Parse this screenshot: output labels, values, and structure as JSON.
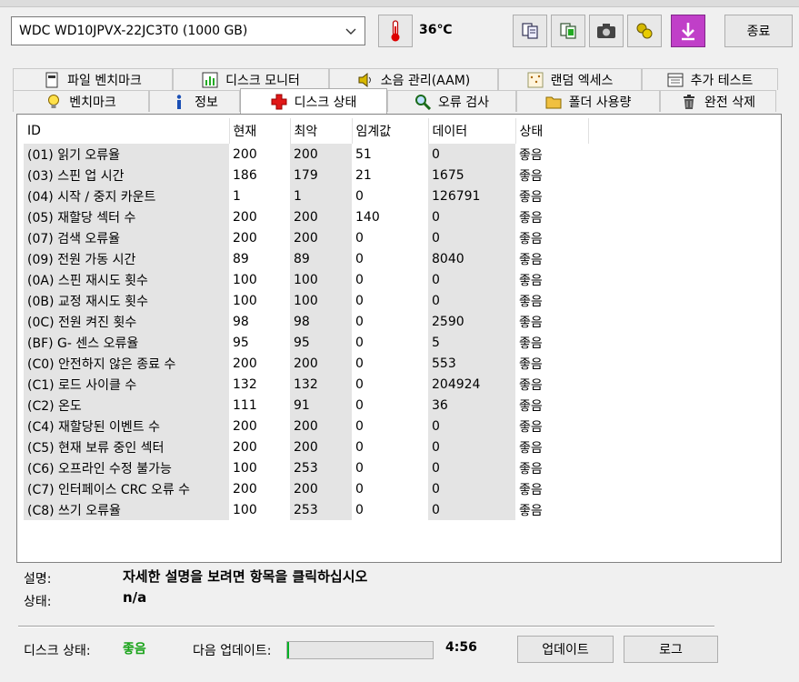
{
  "toolbar": {
    "drive": "WDC WD10JPVX-22JC3T0 (1000 GB)",
    "temperature": "36℃",
    "close_label": "종료"
  },
  "tabs_top": [
    {
      "label": "파일 벤치마크",
      "icon": "file-benchmark-icon"
    },
    {
      "label": "디스크 모니터",
      "icon": "chart-icon"
    },
    {
      "label": "소음 관리(AAM)",
      "icon": "speaker-icon"
    },
    {
      "label": "랜덤 엑세스",
      "icon": "random-access-icon"
    },
    {
      "label": "추가 테스트",
      "icon": "extra-test-icon"
    }
  ],
  "tabs_bottom": [
    {
      "label": "벤치마크",
      "icon": "lightbulb-icon"
    },
    {
      "label": "정보",
      "icon": "info-icon"
    },
    {
      "label": "디스크 상태",
      "icon": "health-cross-icon"
    },
    {
      "label": "오류 검사",
      "icon": "magnifier-icon"
    },
    {
      "label": "폴더 사용량",
      "icon": "folder-icon"
    },
    {
      "label": "완전 삭제",
      "icon": "trash-icon"
    }
  ],
  "table": {
    "headers": [
      "ID",
      "현재",
      "최악",
      "임계값",
      "데이터",
      "상태"
    ],
    "rows": [
      [
        "(01) 읽기 오류율",
        "200",
        "200",
        "51",
        "0",
        "좋음"
      ],
      [
        "(03) 스핀 업 시간",
        "186",
        "179",
        "21",
        "1675",
        "좋음"
      ],
      [
        "(04) 시작 / 중지 카운트",
        "1",
        "1",
        "0",
        "126791",
        "좋음"
      ],
      [
        "(05) 재할당 섹터 수",
        "200",
        "200",
        "140",
        "0",
        "좋음"
      ],
      [
        "(07) 검색 오류율",
        "200",
        "200",
        "0",
        "0",
        "좋음"
      ],
      [
        "(09) 전원 가동 시간",
        "89",
        "89",
        "0",
        "8040",
        "좋음"
      ],
      [
        "(0A) 스핀 재시도 횟수",
        "100",
        "100",
        "0",
        "0",
        "좋음"
      ],
      [
        "(0B) 교정 재시도 횟수",
        "100",
        "100",
        "0",
        "0",
        "좋음"
      ],
      [
        "(0C) 전원 켜진 횟수",
        "98",
        "98",
        "0",
        "2590",
        "좋음"
      ],
      [
        "(BF) G- 센스 오류율",
        "95",
        "95",
        "0",
        "5",
        "좋음"
      ],
      [
        "(C0) 안전하지 않은 종료 수",
        "200",
        "200",
        "0",
        "553",
        "좋음"
      ],
      [
        "(C1) 로드 사이클 수",
        "132",
        "132",
        "0",
        "204924",
        "좋음"
      ],
      [
        "(C2) 온도",
        "111",
        "91",
        "0",
        "36",
        "좋음"
      ],
      [
        "(C4) 재할당된 이벤트 수",
        "200",
        "200",
        "0",
        "0",
        "좋음"
      ],
      [
        "(C5) 현재 보류 중인 섹터",
        "200",
        "200",
        "0",
        "0",
        "좋음"
      ],
      [
        "(C6) 오프라인 수정 불가능",
        "100",
        "253",
        "0",
        "0",
        "좋음"
      ],
      [
        "(C7) 인터페이스 CRC 오류 수",
        "200",
        "200",
        "0",
        "0",
        "좋음"
      ],
      [
        "(C8) 쓰기 오류율",
        "100",
        "253",
        "0",
        "0",
        "좋음"
      ]
    ]
  },
  "description": {
    "desc_label": "설명:",
    "desc_value": "자세한 설명을 보려면 항목을 클릭하십시오",
    "status_label": "상태:",
    "status_value": "n/a"
  },
  "footer": {
    "disk_status_label": "디스크 상태:",
    "disk_status_value": "좋음",
    "next_update_label": "다음 업데이트:",
    "progress_fraction": 0.01,
    "time_remaining": "4:56",
    "update_label": "업데이트",
    "log_label": "로그"
  },
  "colors": {
    "good": "#1aa31a",
    "column_shade": "#e4e4e4"
  }
}
